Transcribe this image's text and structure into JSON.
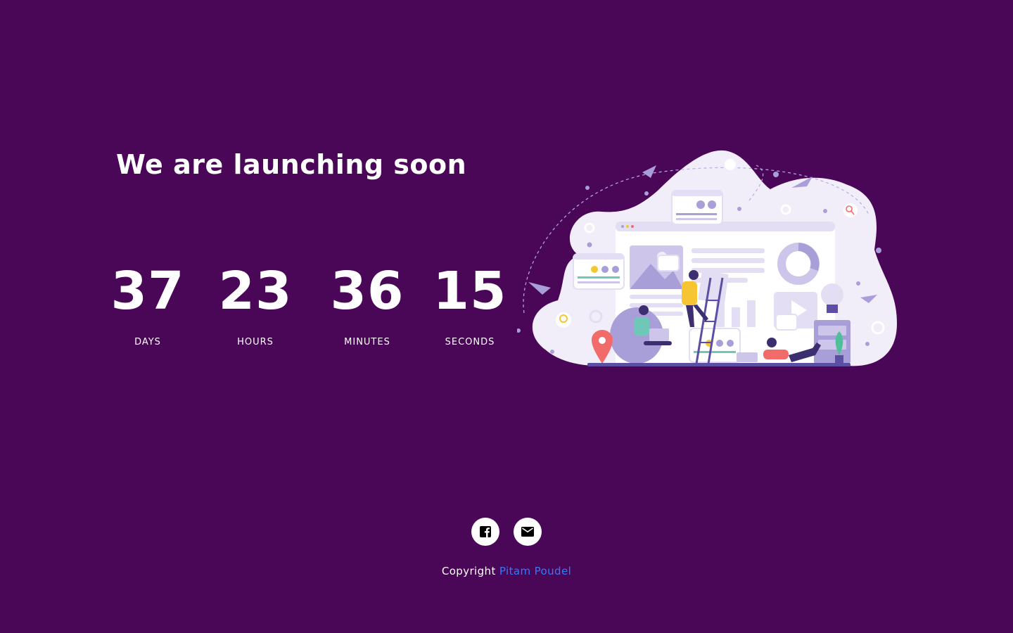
{
  "hero": {
    "title": "We are launching soon"
  },
  "countdown": [
    {
      "value": "37",
      "label": "DAYS"
    },
    {
      "value": "23",
      "label": "HOURS"
    },
    {
      "value": "36",
      "label": "MINUTES"
    },
    {
      "value": "15",
      "label": "SECONDS"
    }
  ],
  "illustration": {
    "icon": "website-launch-illustration",
    "blob_color": "#f1eefa",
    "accent_color": "#a99fd8",
    "highlight_color": "#f7c531",
    "pin_color": "#f26b6b"
  },
  "social": {
    "facebook_icon": "facebook-icon",
    "email_icon": "email-icon"
  },
  "footer": {
    "copyright_text": "Copyright",
    "author_name": "Pitam Poudel",
    "link_color": "#2f7bff"
  },
  "colors": {
    "background": "#4a0657",
    "text": "#ffffff"
  }
}
